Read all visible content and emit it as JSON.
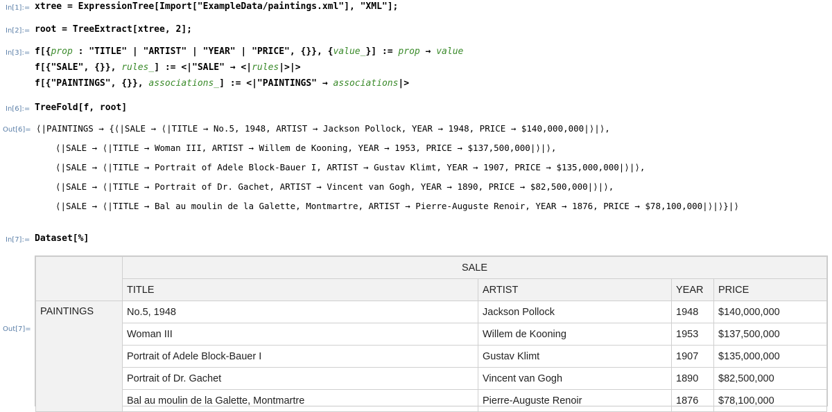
{
  "cells": {
    "in1": {
      "label": "In[1]:=",
      "code": "xtree = ExpressionTree[Import[\"ExampleData/paintings.xml\"], \"XML\"];"
    },
    "in2": {
      "label": "In[2]:=",
      "code": "root = TreeExtract[xtree, 2];"
    },
    "in3": {
      "label": "In[3]:=",
      "l1_prefix": "f[{",
      "l1_var1": "prop",
      "l1_mid": " : \"TITLE\" | \"ARTIST\" | \"YEAR\" | \"PRICE\", {}}, {",
      "l1_var2": "value_",
      "l1_mid2": "}] := ",
      "l1_var3": "prop",
      "l1_arrow": " → ",
      "l1_var4": "value",
      "l2_prefix": "f[{\"SALE\", {}}, ",
      "l2_var1": "rules_",
      "l2_mid": "] := <|\"SALE\" → <|",
      "l2_var2": "rules",
      "l2_end": "|>|>",
      "l3_prefix": "f[{\"PAINTINGS\", {}}, ",
      "l3_var1": "associations_",
      "l3_mid": "] := <|\"PAINTINGS\" → ",
      "l3_var2": "associations",
      "l3_end": "|>"
    },
    "in6": {
      "label": "In[6]:=",
      "code": "TreeFold[f, root]"
    },
    "out6": {
      "label": "Out[6]=",
      "lines": [
        "⟨|PAINTINGS → {⟨|SALE → ⟨|TITLE → No.5, 1948, ARTIST → Jackson Pollock, YEAR → 1948, PRICE → $140,000,000|⟩|⟩,",
        "⟨|SALE → ⟨|TITLE → Woman III, ARTIST → Willem de Kooning, YEAR → 1953, PRICE → $137,500,000|⟩|⟩,",
        "⟨|SALE → ⟨|TITLE → Portrait of Adele Block-Bauer I, ARTIST → Gustav Klimt, YEAR → 1907, PRICE → $135,000,000|⟩|⟩,",
        "⟨|SALE → ⟨|TITLE → Portrait of Dr. Gachet, ARTIST → Vincent van Gogh, YEAR → 1890, PRICE → $82,500,000|⟩|⟩,",
        "⟨|SALE → ⟨|TITLE → Bal au moulin de la Galette, Montmartre, ARTIST → Pierre-Auguste Renoir, YEAR → 1876, PRICE → $78,100,000|⟩|⟩}|⟩"
      ]
    },
    "in7": {
      "label": "In[7]:=",
      "code": "Dataset[%]"
    },
    "out7": {
      "label": "Out[7]="
    }
  },
  "dataset": {
    "group_header": "SALE",
    "row_header": "PAINTINGS",
    "columns": [
      "TITLE",
      "ARTIST",
      "YEAR",
      "PRICE"
    ],
    "rows": [
      [
        "No.5, 1948",
        "Jackson Pollock",
        "1948",
        "$140,000,000"
      ],
      [
        "Woman III",
        "Willem de Kooning",
        "1953",
        "$137,500,000"
      ],
      [
        "Portrait of Adele Block-Bauer I",
        "Gustav Klimt",
        "1907",
        "$135,000,000"
      ],
      [
        "Portrait of Dr. Gachet",
        "Vincent van Gogh",
        "1890",
        "$82,500,000"
      ],
      [
        "Bal au moulin de la Galette, Montmartre",
        "Pierre-Auguste Renoir",
        "1876",
        "$78,100,000"
      ]
    ]
  }
}
